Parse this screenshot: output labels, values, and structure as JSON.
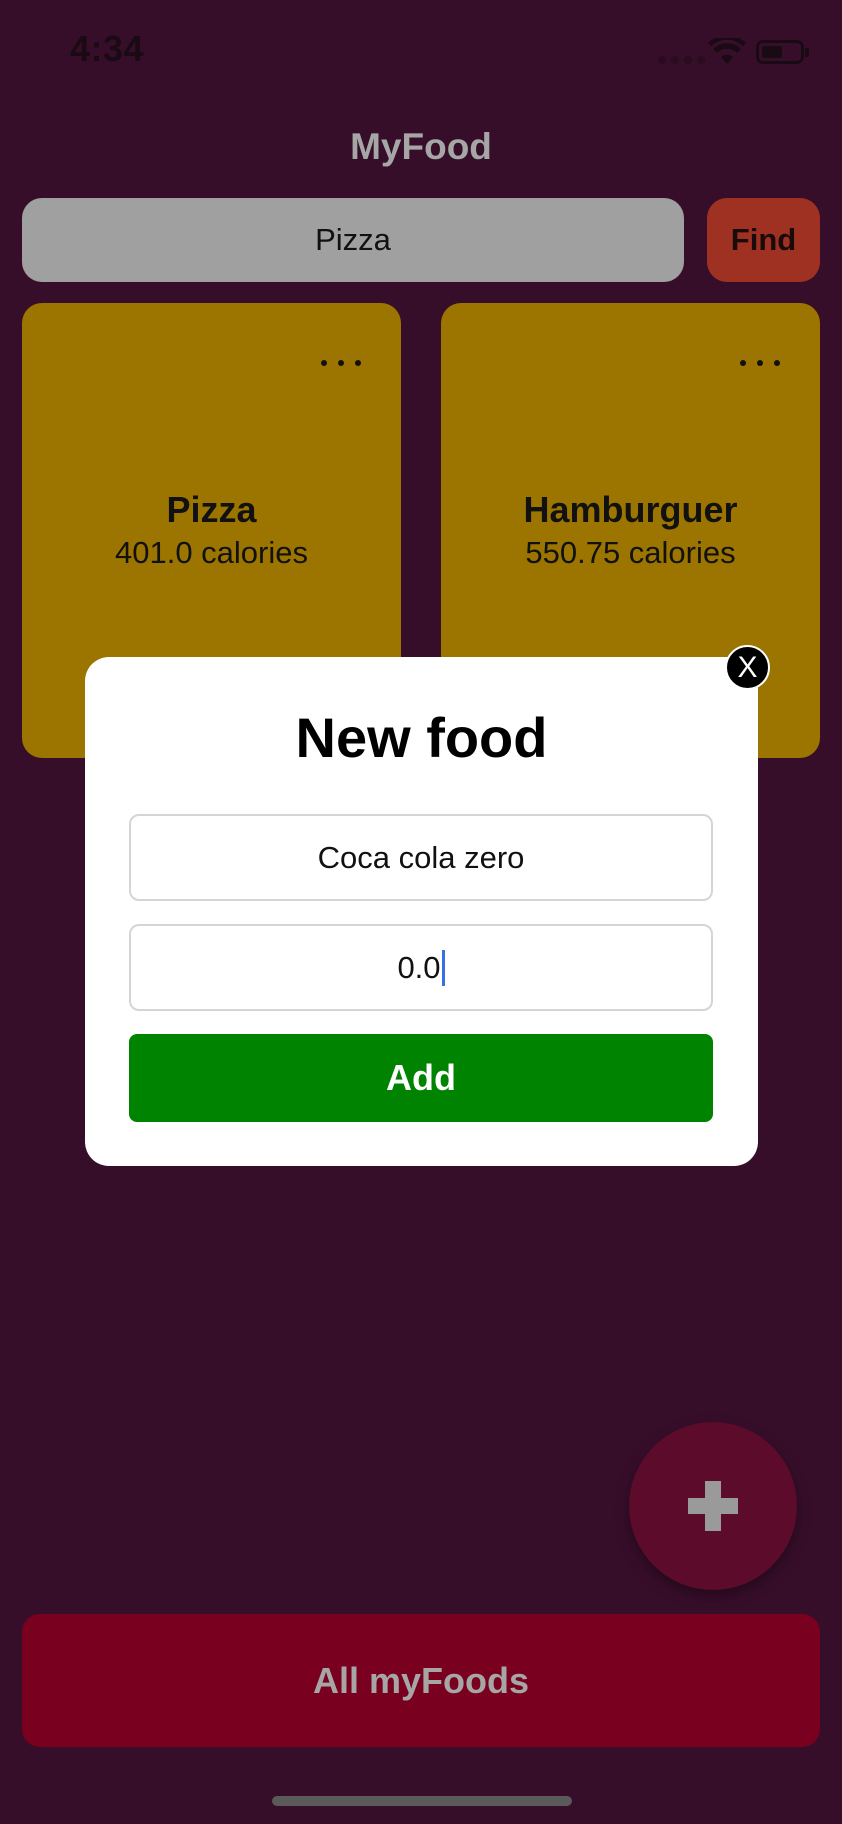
{
  "status_bar": {
    "time": "4:34"
  },
  "header": {
    "title": "MyFood"
  },
  "search": {
    "value": "Pizza",
    "find_label": "Find"
  },
  "foods": [
    {
      "name": "Pizza",
      "calories": "401.0 calories"
    },
    {
      "name": "Hamburguer",
      "calories": "550.75 calories"
    }
  ],
  "modal": {
    "title": "New food",
    "name_value": "Coca cola zero",
    "calories_value": "0.0",
    "add_label": "Add",
    "close_label": "X"
  },
  "footer": {
    "all_foods_label": "All myFoods"
  },
  "colors": {
    "background": "#370e2a",
    "card": "#9b7500",
    "find_button": "#9e3121",
    "add_button": "#008300",
    "fab": "#5c0b2b",
    "bottom_button": "#7a0020"
  },
  "icons": [
    "wifi-icon",
    "battery-icon",
    "more-icon",
    "close-icon",
    "plus-icon"
  ]
}
